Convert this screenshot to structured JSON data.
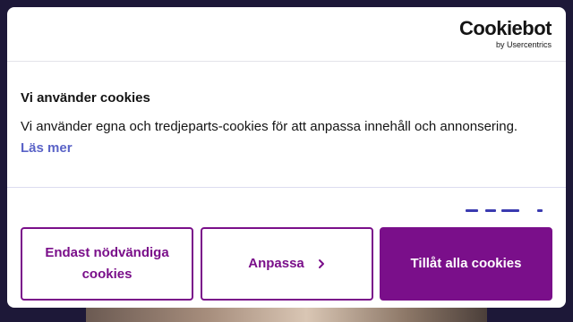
{
  "banner": {
    "logo": {
      "main": "Cookiebot",
      "sub": "by Usercentrics"
    },
    "title": "Vi använder cookies",
    "body": "Vi använder egna och tredjeparts-cookies för att anpassa innehåll och annonsering.",
    "read_more": "Läs mer"
  },
  "buttons": {
    "necessary": "Endast nödvändiga cookies",
    "customize": "Anpassa",
    "allow_all": "Tillåt alla cookies"
  },
  "colors": {
    "brand": "#7a0f8a",
    "link": "#5a63c7",
    "backdrop": "#1d1838"
  },
  "icons": {
    "customize_chevron": "chevron-right-icon"
  }
}
